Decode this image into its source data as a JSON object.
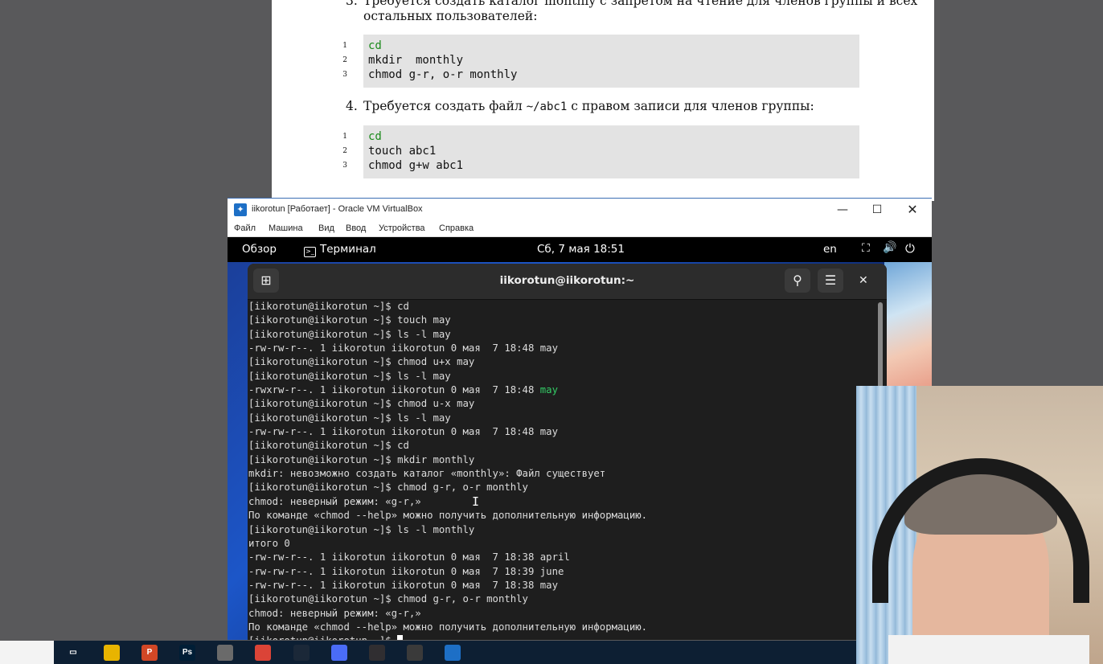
{
  "pdf": {
    "step3": {
      "number": "3.",
      "line1": "Требуется создать каталог monthly с запретом на чтение для членов группы и всех",
      "line2": "остальных пользователей:"
    },
    "code1": [
      {
        "n": "1",
        "t": "cd"
      },
      {
        "n": "2",
        "t": "mkdir  monthly"
      },
      {
        "n": "3",
        "t": "chmod g-r, o-r monthly"
      }
    ],
    "step4": {
      "number": "4.",
      "pre": "Требуется создать файл ",
      "code": "~/abc1",
      "post": " с правом записи для членов группы:"
    },
    "code2": [
      {
        "n": "1",
        "t": "cd"
      },
      {
        "n": "2",
        "t": "touch abc1"
      },
      {
        "n": "3",
        "t": "chmod g+w abc1"
      }
    ]
  },
  "vbox": {
    "title": "iikorotun [Работает] - Oracle VM VirtualBox",
    "menu": [
      "Файл",
      "Машина",
      "Вид",
      "Ввод",
      "Устройства",
      "Справка"
    ]
  },
  "gnome": {
    "overview": "Обзор",
    "terminal_app": "Терминал",
    "clock": "Сб, 7 мая  18:51",
    "lang": "en"
  },
  "terminal": {
    "title": "iikorotun@iikorotun:~",
    "lines": [
      "[iikorotun@iikorotun ~]$ cd",
      "[iikorotun@iikorotun ~]$ touch may",
      "[iikorotun@iikorotun ~]$ ls -l may",
      "-rw-rw-r--. 1 iikorotun iikorotun 0 мая  7 18:48 may",
      "[iikorotun@iikorotun ~]$ chmod u+x may",
      "[iikorotun@iikorotun ~]$ ls -l may",
      "-rwxrw-r--. 1 iikorotun iikorotun 0 мая  7 18:48 ",
      "[iikorotun@iikorotun ~]$ chmod u-x may",
      "[iikorotun@iikorotun ~]$ ls -l may",
      "-rw-rw-r--. 1 iikorotun iikorotun 0 мая  7 18:48 may",
      "[iikorotun@iikorotun ~]$ cd",
      "[iikorotun@iikorotun ~]$ mkdir monthly",
      "mkdir: невозможно создать каталог «monthly»: Файл существует",
      "[iikorotun@iikorotun ~]$ chmod g-r, o-r monthly",
      "chmod: неверный режим: «g-r,»",
      "По команде «chmod --help» можно получить дополнительную информацию.",
      "[iikorotun@iikorotun ~]$ ls -l monthly",
      "итого 0",
      "-rw-rw-r--. 1 iikorotun iikorotun 0 мая  7 18:38 april",
      "-rw-rw-r--. 1 iikorotun iikorotun 0 мая  7 18:39 june",
      "-rw-rw-r--. 1 iikorotun iikorotun 0 мая  7 18:38 may",
      "[iikorotun@iikorotun ~]$ chmod g-r, o-r monthly",
      "chmod: неверный режим: «g-r,»",
      "По команде «chmod --help» можно получить дополнительную информацию.",
      "[iikorotun@iikorotun ~]$ "
    ],
    "exec_file": "may"
  },
  "colors": {
    "exec_file": "#33cc66",
    "code_keyword": "#1a8a1a",
    "terminal_bg": "#1e1e1e"
  },
  "icons": [
    "new-tab-icon",
    "search-icon",
    "hamburger-menu-icon",
    "close-icon",
    "network-icon",
    "volume-icon",
    "power-icon",
    "virtualbox-logo-icon"
  ],
  "taskbar": {
    "apps": [
      "task-view",
      "file-explorer",
      "powerpoint",
      "photoshop",
      "app-5",
      "chrome",
      "steam",
      "chrome-alt",
      "obs",
      "app-10",
      "virtualbox"
    ],
    "labels": {
      "powerpoint": "P",
      "photoshop": "Ps"
    }
  }
}
